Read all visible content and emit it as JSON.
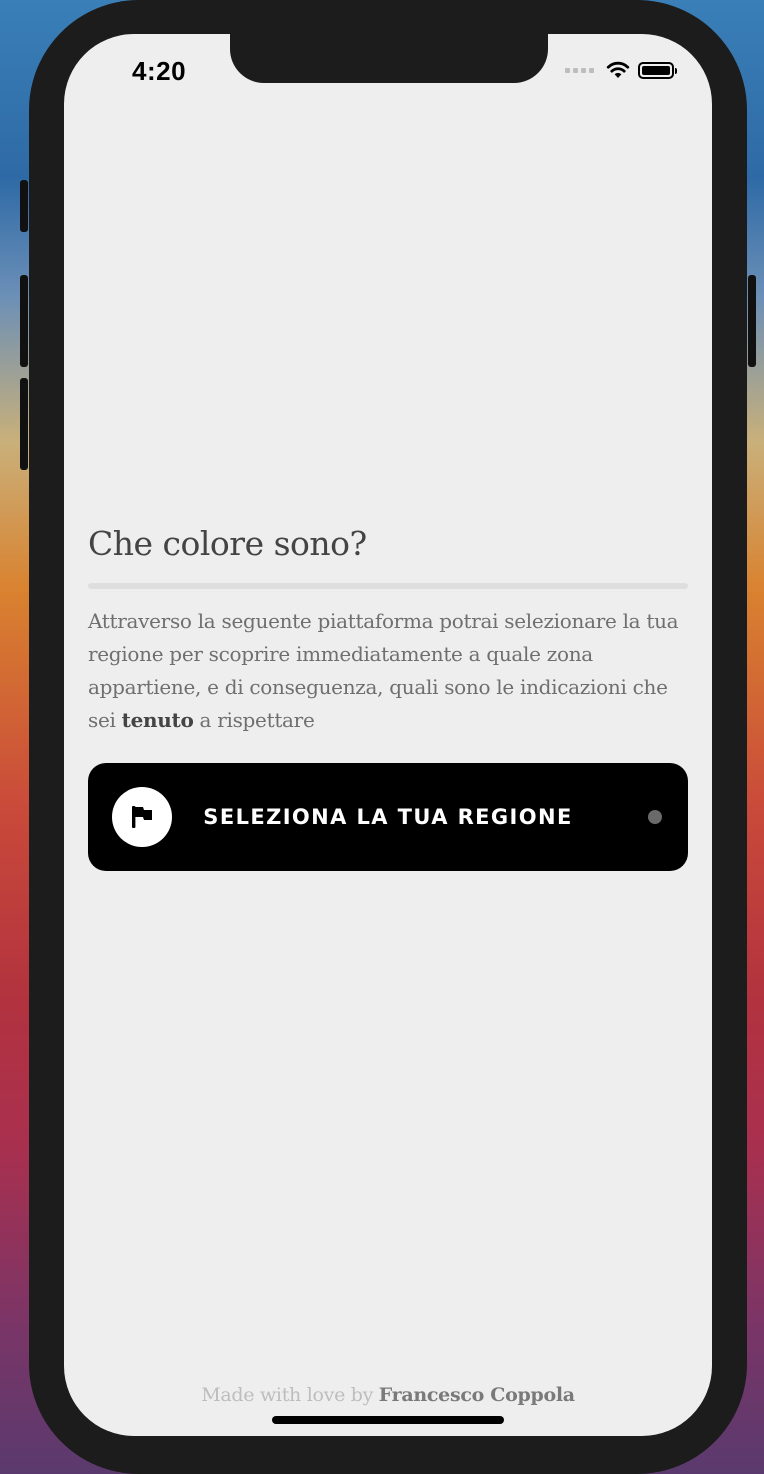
{
  "status_bar": {
    "time": "4:20"
  },
  "main": {
    "title": "Che colore sono?",
    "description_before": "Attraverso la seguente piattaforma potrai selezionare la tua regione per scoprire immediatamente a quale zona appartiene, e di conseguenza, quali sono le indicazioni che sei ",
    "description_bold": "tenuto",
    "description_after": " a rispettare",
    "select_button_label": "SELEZIONA LA TUA REGIONE",
    "select_button_icon": "flag-icon"
  },
  "footer": {
    "prefix": "Made with love by ",
    "author": "Francesco Coppola"
  },
  "colors": {
    "screen_background": "#eeeeee",
    "button_background": "#000000",
    "title_text": "#444444",
    "body_text": "#6f6f6f"
  }
}
